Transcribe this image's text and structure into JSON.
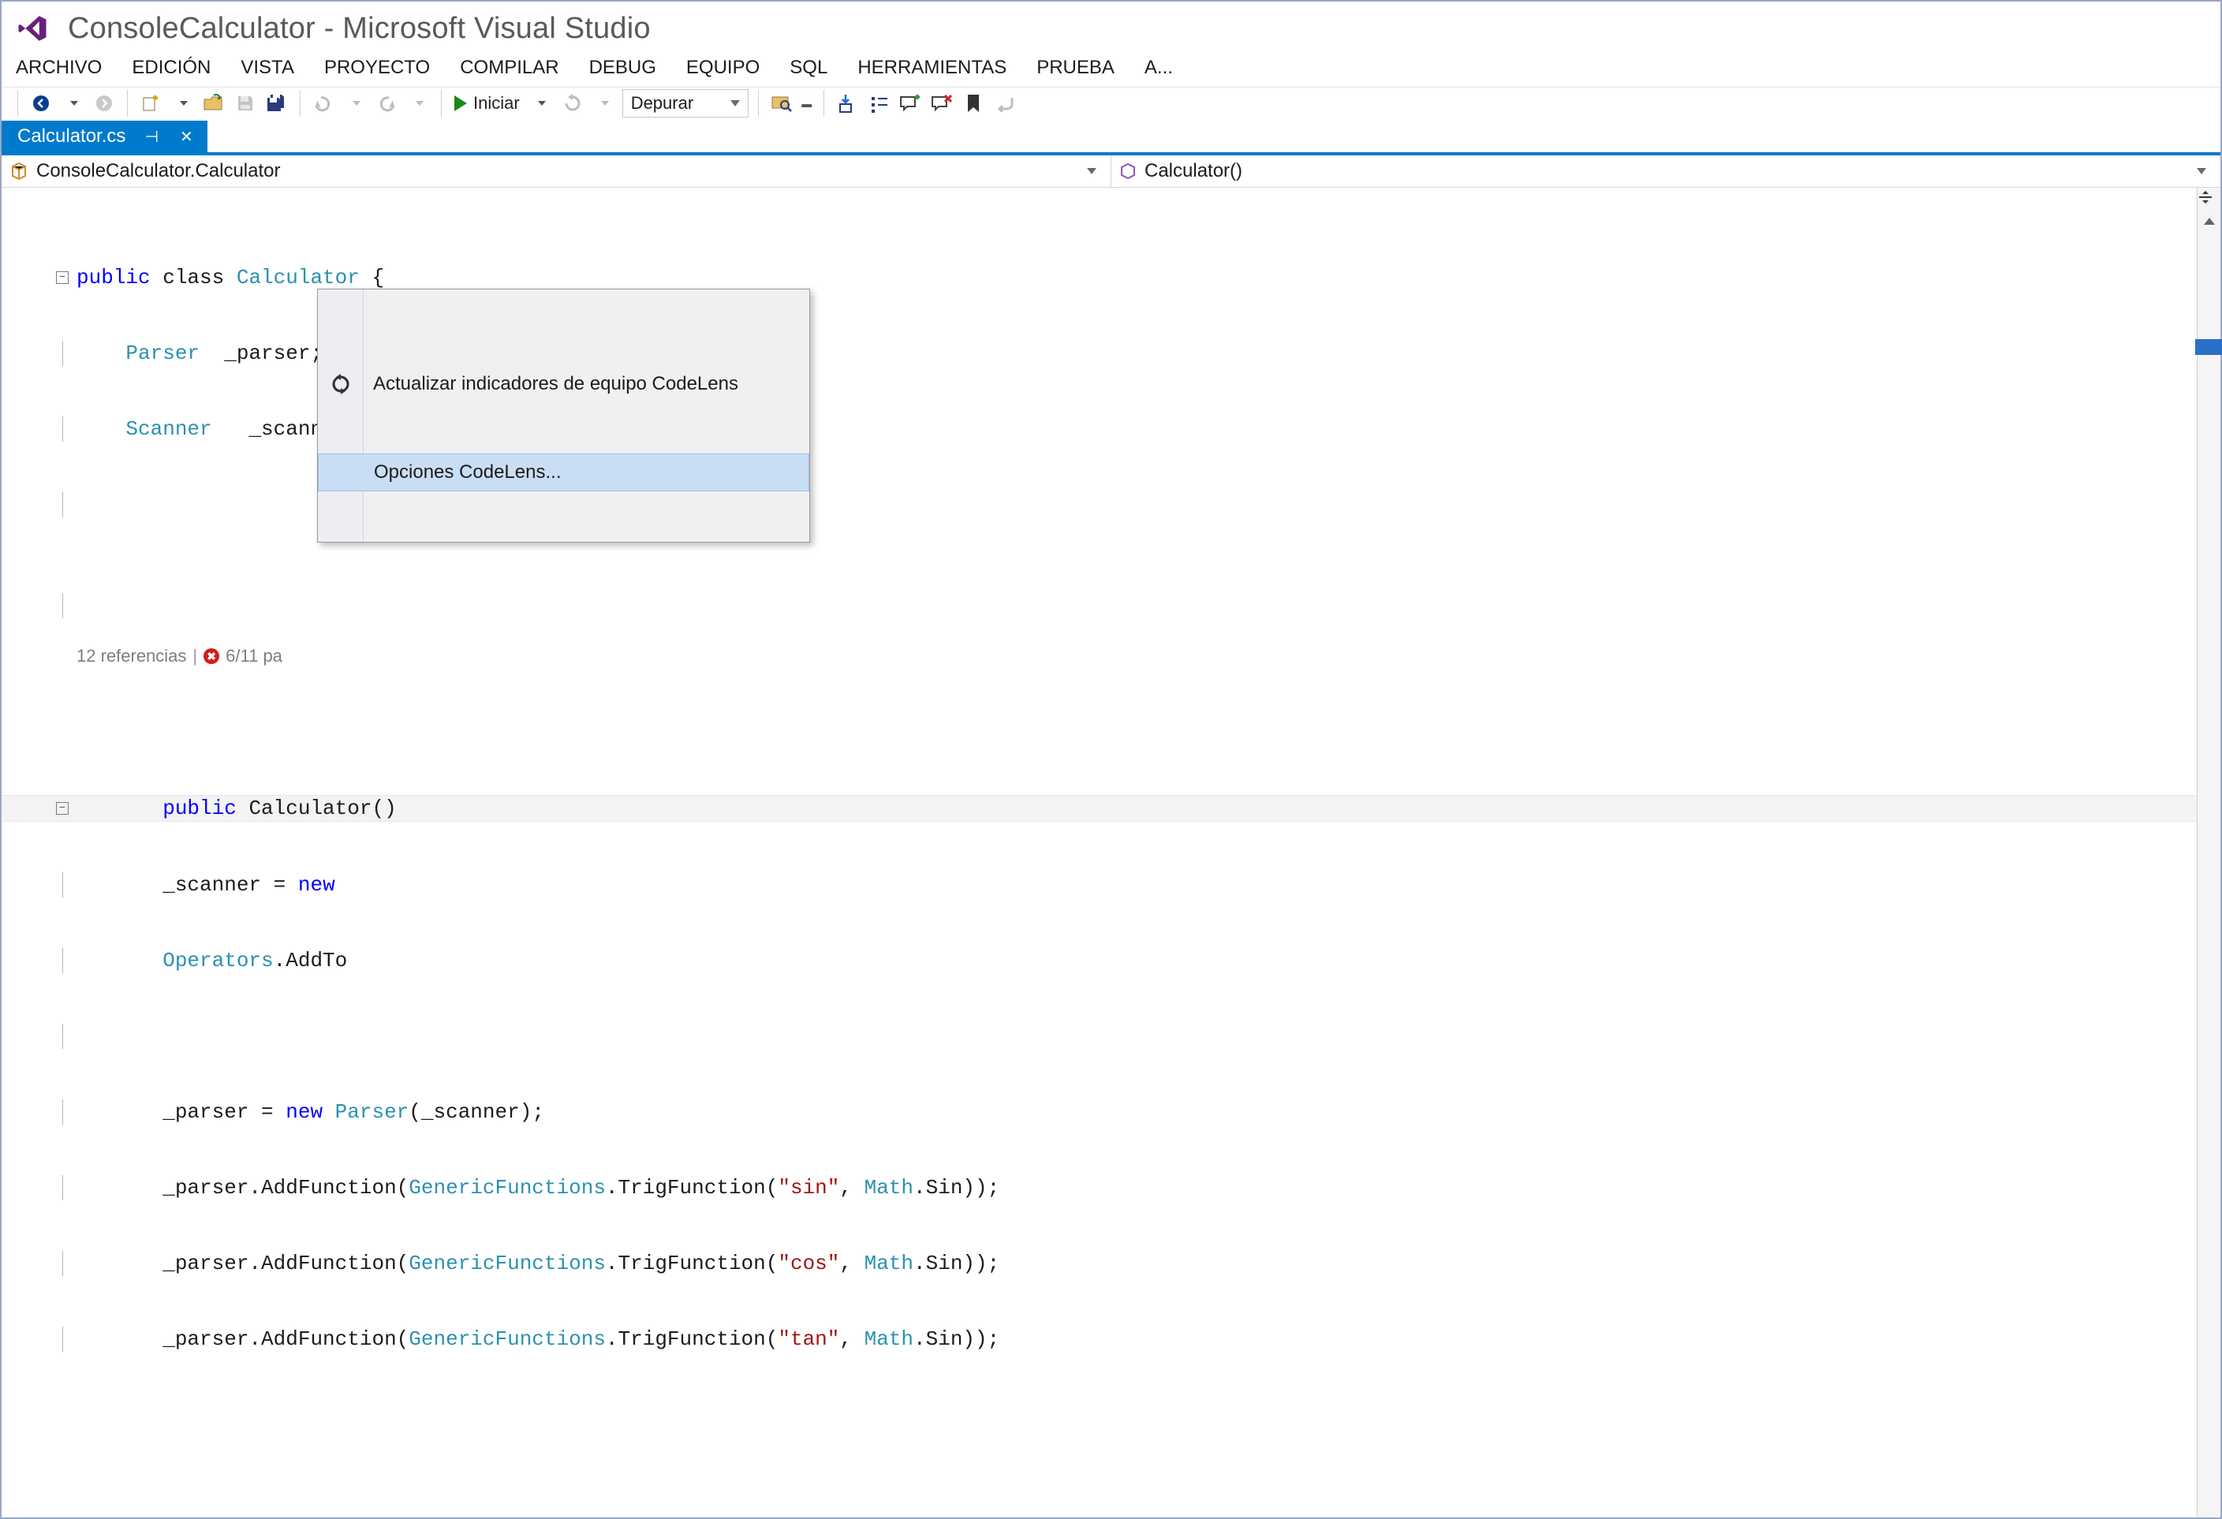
{
  "title": "ConsoleCalculator - Microsoft Visual Studio",
  "menu": [
    "ARCHIVO",
    "EDICIÓN",
    "VISTA",
    "PROYECTO",
    "COMPILAR",
    "DEBUG",
    "EQUIPO",
    "SQL",
    "HERRAMIENTAS",
    "PRUEBA",
    "A..."
  ],
  "toolbar": {
    "start_label": "Iniciar",
    "config_label": "Depurar"
  },
  "tab": {
    "name": "Calculator.cs"
  },
  "nav": {
    "class": "ConsoleCalculator.Calculator",
    "member": "Calculator()"
  },
  "codelens": {
    "references": "12 referencias",
    "status": "6/11 pa"
  },
  "code": {
    "l1a": "public",
    "l1b": " class ",
    "l1c": "Calculator",
    "l1d": " {",
    "l2a": "    Parser",
    "l2b": "  _parser;",
    "l3a": "    Scanner",
    "l3b": "   _scanner;",
    "l4a": "    public",
    "l4b": " Calculator()",
    "l5a": "       _scanner = ",
    "l5b": "new",
    "l6a": "       Operators",
    "l6b": ".AddTo",
    "l7a": "       _parser = ",
    "l7b": "new ",
    "l7c": "Parser",
    "l7d": "(_scanner);",
    "l8a": "       _parser.AddFunction(",
    "l8b": "GenericFunctions",
    "l8c": ".TrigFunction(",
    "l8d": "\"sin\"",
    "l8e": ", ",
    "l8f": "Math",
    "l8g": ".Sin));",
    "l9a": "       _parser.AddFunction(",
    "l9b": "GenericFunctions",
    "l9c": ".TrigFunction(",
    "l9d": "\"cos\"",
    "l9e": ", ",
    "l9f": "Math",
    "l9g": ".Sin));",
    "l10a": "       _parser.AddFunction(",
    "l10b": "GenericFunctions",
    "l10c": ".TrigFunction(",
    "l10d": "\"tan\"",
    "l10e": ", ",
    "l10f": "Math",
    "l10g": ".Sin));"
  },
  "context_menu": {
    "item1": "Actualizar indicadores de equipo CodeLens",
    "item2": "Opciones CodeLens..."
  }
}
